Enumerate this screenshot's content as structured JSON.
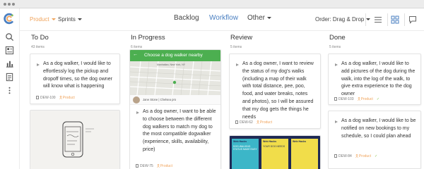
{
  "topbar": {
    "product_label": "Product",
    "sprints_label": "Sprints",
    "tabs": [
      {
        "label": "Backlog",
        "active": false
      },
      {
        "label": "Workflow",
        "active": true
      },
      {
        "label": "Other",
        "active": false
      }
    ],
    "order_label": "Order: Drag & Drop"
  },
  "sidebar": {
    "icons": [
      "search-icon",
      "board-icon",
      "chart-icon",
      "document-icon",
      "more-icon"
    ]
  },
  "colors": {
    "accent": "#4a7fc1",
    "product": "#f0a35a",
    "green": "#8cc44c",
    "mockup_header": "#4caf50"
  },
  "columns": [
    {
      "title": "To Do",
      "count": "43 items",
      "cards": [
        {
          "text": "As a dog walker, I would like to effortlessly log the pickup and dropoff times, so the dog owner will know what is happening",
          "id": "DEW-100",
          "tag": "Product"
        }
      ]
    },
    {
      "title": "In Progress",
      "count": "6 items",
      "mockup": {
        "header": "Choose a dog walker nearby",
        "map_caption": "Manhattan, New York, NY",
        "profile_name": "Jane Stone | Chelsea pro"
      },
      "cards": [
        {
          "text": "As a dog owner, I want to be able to choose between the different dog walkers to match my dog to the most compatible dogwalker (experience, skills, availability, price)",
          "id": "DEW-75",
          "tag": "Product"
        }
      ]
    },
    {
      "title": "Review",
      "count": "5 items",
      "cards": [
        {
          "text": "As a dog owner, I want to review the status of my dog's walks (including a map of their walk with total distance, pee, poo, food, and water breaks, notes and photos), so I will be assured that my dog gets the things he needs",
          "id": "DEW-62",
          "tag": "Product"
        }
      ],
      "stickies": [
        {
          "title": "Web Hacks",
          "body": "DOG-WALKING STATUS MADE EASY"
        },
        {
          "title": "Web Hacks",
          "body": "YOUR DOG NEEDS"
        },
        {
          "title": "Web Hacks",
          "body": ""
        }
      ]
    },
    {
      "title": "Done",
      "count": "5 items",
      "cards": [
        {
          "text": "As a dog walker, I would like to add pictures of the dog during the walk, into the log of the walk, to give extra experience to the dog owner",
          "id": "DEW-103",
          "tag": "Product",
          "done": true
        },
        {
          "text": "As a dog walker, I would like to be notified on new bookings to my schedule, so I could plan ahead",
          "id": "DEW-84",
          "tag": "Product",
          "done": true
        }
      ]
    }
  ]
}
